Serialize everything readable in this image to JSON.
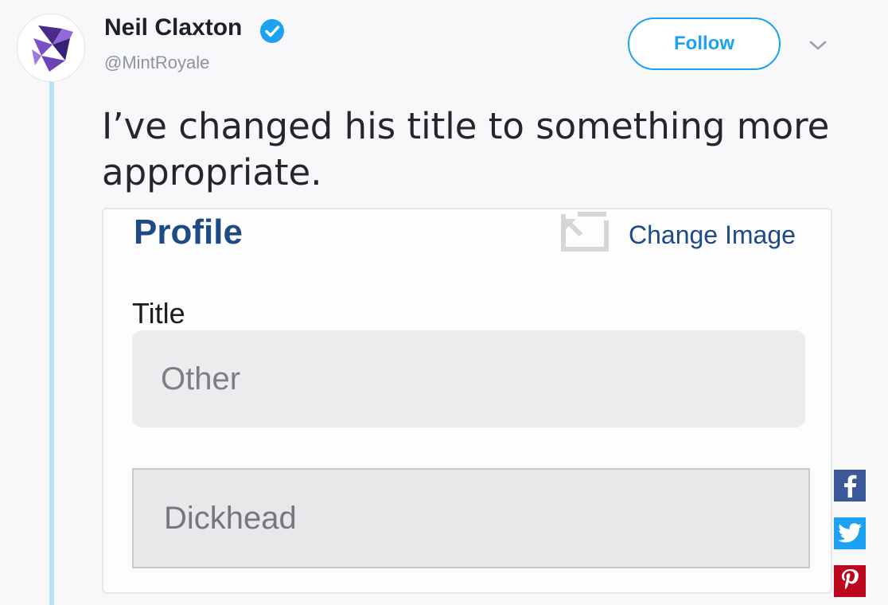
{
  "tweet": {
    "author_name": "Neil Claxton",
    "handle": "@MintRoyale",
    "follow_label": "Follow",
    "text": "I’ve changed his title to something more appropriate."
  },
  "screenshot_card": {
    "heading": "Profile",
    "change_image_label": "Change Image",
    "title_label": "Title",
    "title_value_original": "Other",
    "title_value_edited": "Dickhead"
  },
  "icons": {
    "verified": "verified-badge-icon",
    "menu": "chevron-down-icon",
    "change_image": "change-image-icon",
    "share": [
      "facebook-icon",
      "twitter-icon",
      "pinterest-icon"
    ]
  },
  "colors": {
    "accent": "#1da1f2",
    "profile_blue": "#1e4a86",
    "facebook": "#3b5998",
    "pinterest": "#bd081c"
  }
}
